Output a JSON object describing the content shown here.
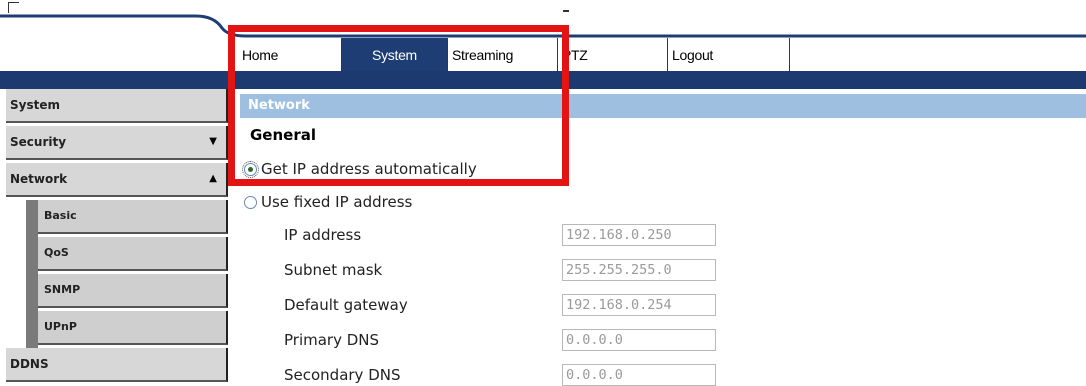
{
  "nav": {
    "tabs": [
      {
        "label": "Home"
      },
      {
        "label": "System"
      },
      {
        "label": "Streaming"
      },
      {
        "label": "PTZ"
      },
      {
        "label": "Logout"
      }
    ],
    "active": "System"
  },
  "sidebar": {
    "items": [
      {
        "label": "System"
      },
      {
        "label": "Security",
        "arrow": "▼"
      },
      {
        "label": "Network",
        "arrow": "▲"
      },
      {
        "label": "DDNS"
      }
    ],
    "network_subitems": [
      {
        "label": "Basic"
      },
      {
        "label": "QoS"
      },
      {
        "label": "SNMP"
      },
      {
        "label": "UPnP"
      }
    ]
  },
  "main": {
    "section_title": "Network",
    "subheading": "General",
    "options": {
      "auto": {
        "label": "Get IP address automatically",
        "checked": true
      },
      "fixed": {
        "label": "Use fixed IP address",
        "checked": false
      }
    },
    "fields": [
      {
        "label": "IP address",
        "value": "192.168.0.250"
      },
      {
        "label": "Subnet mask",
        "value": "255.255.255.0"
      },
      {
        "label": "Default gateway",
        "value": "192.168.0.254"
      },
      {
        "label": "Primary DNS",
        "value": "0.0.0.0"
      },
      {
        "label": "Secondary DNS",
        "value": "0.0.0.0"
      }
    ]
  },
  "colors": {
    "nav_dark": "#1e3d75",
    "section_header": "#9fbfe0",
    "highlight": "#e31414"
  },
  "icons": [
    "radio-selected-icon",
    "radio-unselected-icon",
    "chevron-down-icon",
    "chevron-up-icon"
  ]
}
